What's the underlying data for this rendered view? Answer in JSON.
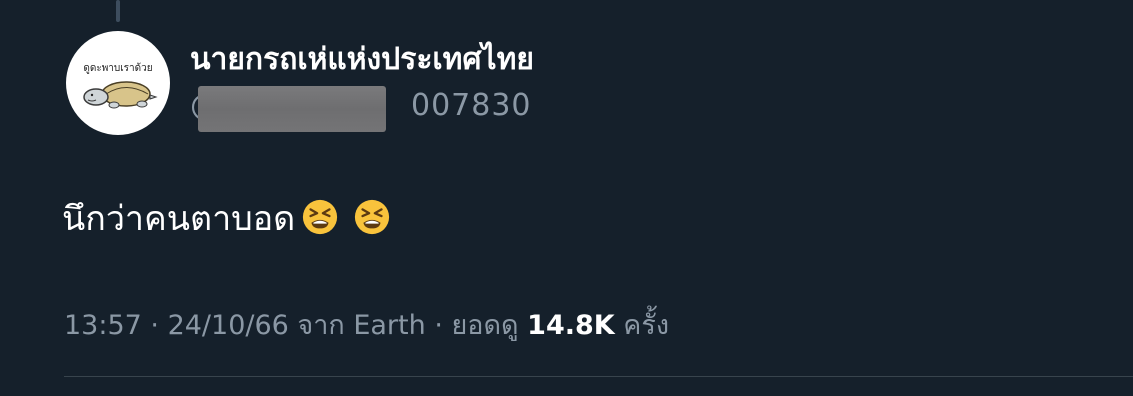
{
  "tweet": {
    "author": {
      "display_name": "นายกรถเห่แห่งประเทศไทย",
      "handle_visible_suffix": "007830",
      "handle_prefix": "@",
      "avatar_caption": "ดูดะพาบเราด้วย"
    },
    "text": "นึกว่าคนตาบอด",
    "emojis": [
      "tired-face-emoji",
      "tired-face-emoji"
    ],
    "meta": {
      "time": "13:57",
      "sep1": " · ",
      "date": "24/10/66",
      "source_prefix": " จาก ",
      "source": "Earth",
      "sep2": " · ",
      "views_prefix": "ยอดดู ",
      "views_count": "14.8K",
      "views_suffix": " ครั้ง"
    }
  },
  "colors": {
    "background": "#15202b",
    "primary_text": "#ffffff",
    "secondary_text": "#8b98a5",
    "divider": "#38444d"
  }
}
